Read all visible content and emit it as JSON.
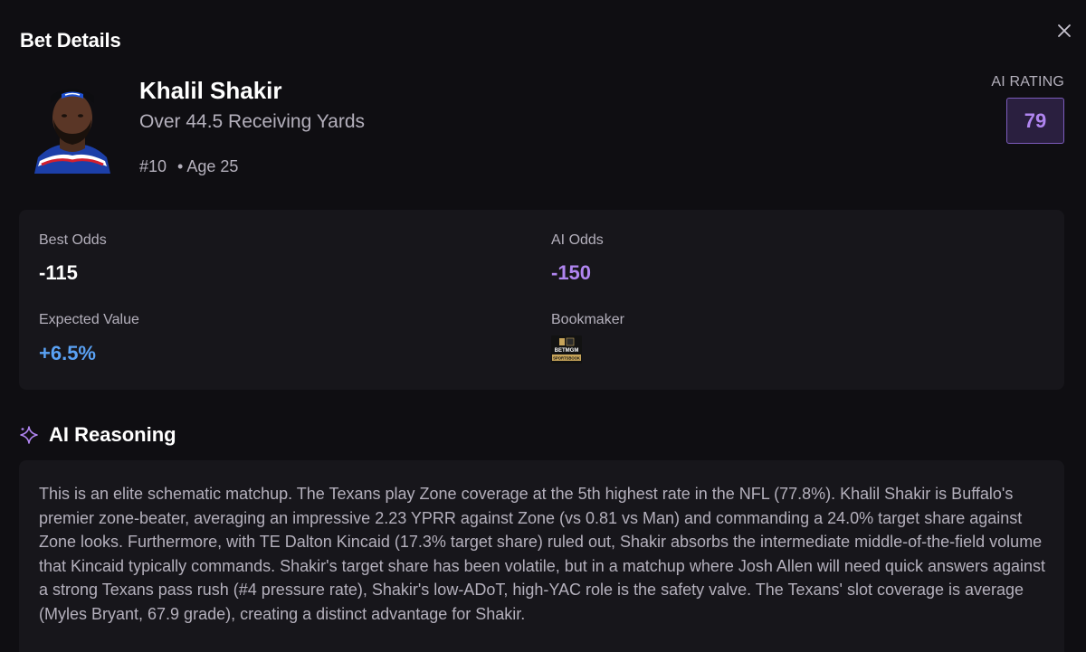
{
  "header": {
    "title": "Bet Details",
    "close_icon": "close-icon"
  },
  "player": {
    "name": "Khalil Shakir",
    "bet_line": "Over 44.5 Receiving Yards",
    "number": "#10",
    "age": "Age 25",
    "avatar_icon": "player-headshot"
  },
  "ai_rating": {
    "label": "AI RATING",
    "value": "79"
  },
  "stats": {
    "best_odds_label": "Best Odds",
    "best_odds_value": "-115",
    "ai_odds_label": "AI Odds",
    "ai_odds_value": "-150",
    "ev_label": "Expected Value",
    "ev_value": "+6.5%",
    "bookmaker_label": "Bookmaker",
    "bookmaker_logo_text_1": "BETMGM",
    "bookmaker_logo_text_2": "SPORTSBOOK"
  },
  "reasoning": {
    "title": "AI Reasoning",
    "icon": "sparkle-icon",
    "text": "This is an elite schematic matchup. The Texans play Zone coverage at the 5th highest rate in the NFL (77.8%). Khalil Shakir is Buffalo's premier zone-beater, averaging an impressive 2.23 YPRR against Zone (vs 0.81 vs Man) and commanding a 24.0% target share against Zone looks. Furthermore, with TE Dalton Kincaid (17.3% target share) ruled out, Shakir absorbs the intermediate middle-of-the-field volume that Kincaid typically commands. Shakir's target share has been volatile, but in a matchup where Josh Allen will need quick answers against a strong Texans pass rush (#4 pressure rate), Shakir's low-ADoT, high-YAC role is the safety valve. The Texans' slot coverage is average (Myles Bryant, 67.9 grade), creating a distinct advantage for Shakir."
  },
  "colors": {
    "background": "#0f0e12",
    "card": "#17161b",
    "accent_purple": "#b085f0",
    "accent_blue": "#5aa2f5",
    "muted_text": "#b4b0bc"
  }
}
